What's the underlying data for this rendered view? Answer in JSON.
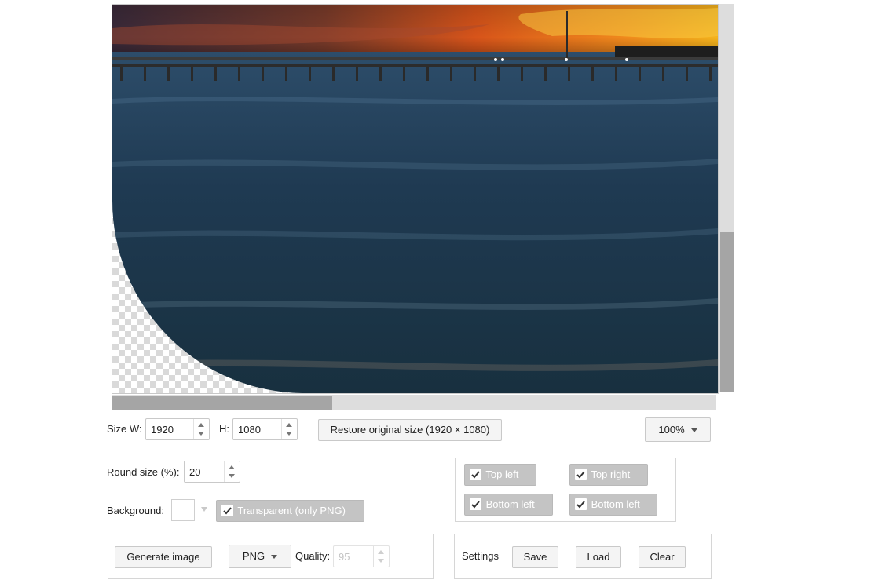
{
  "size": {
    "w_label": "Size W:",
    "w_value": "1920",
    "h_label": "H:",
    "h_value": "1080",
    "restore_label": "Restore original size (1920 × 1080)"
  },
  "zoom": {
    "value": "100%"
  },
  "round": {
    "label": "Round size (%):",
    "value": "20"
  },
  "background": {
    "label": "Background:",
    "color": "#ffffff",
    "transparent_label": "Transparent (only PNG)",
    "transparent_checked": true
  },
  "corners": [
    {
      "label": "Top left",
      "checked": true
    },
    {
      "label": "Top right",
      "checked": true
    },
    {
      "label": "Bottom left",
      "checked": true
    },
    {
      "label": "Bottom left",
      "checked": true
    }
  ],
  "generate": {
    "button_label": "Generate image",
    "format": "PNG",
    "quality_label": "Quality:",
    "quality_value": "95"
  },
  "settings": {
    "label": "Settings",
    "save_label": "Save",
    "load_label": "Load",
    "clear_label": "Clear"
  },
  "scroll": {
    "horizontal_fraction": 0.36,
    "vertical_fraction": 0.59
  },
  "colors": {
    "button_bg": "#f4f4f4",
    "checked_bg": "#c4c4c4",
    "scroll_thumb": "#a5a5a5"
  }
}
